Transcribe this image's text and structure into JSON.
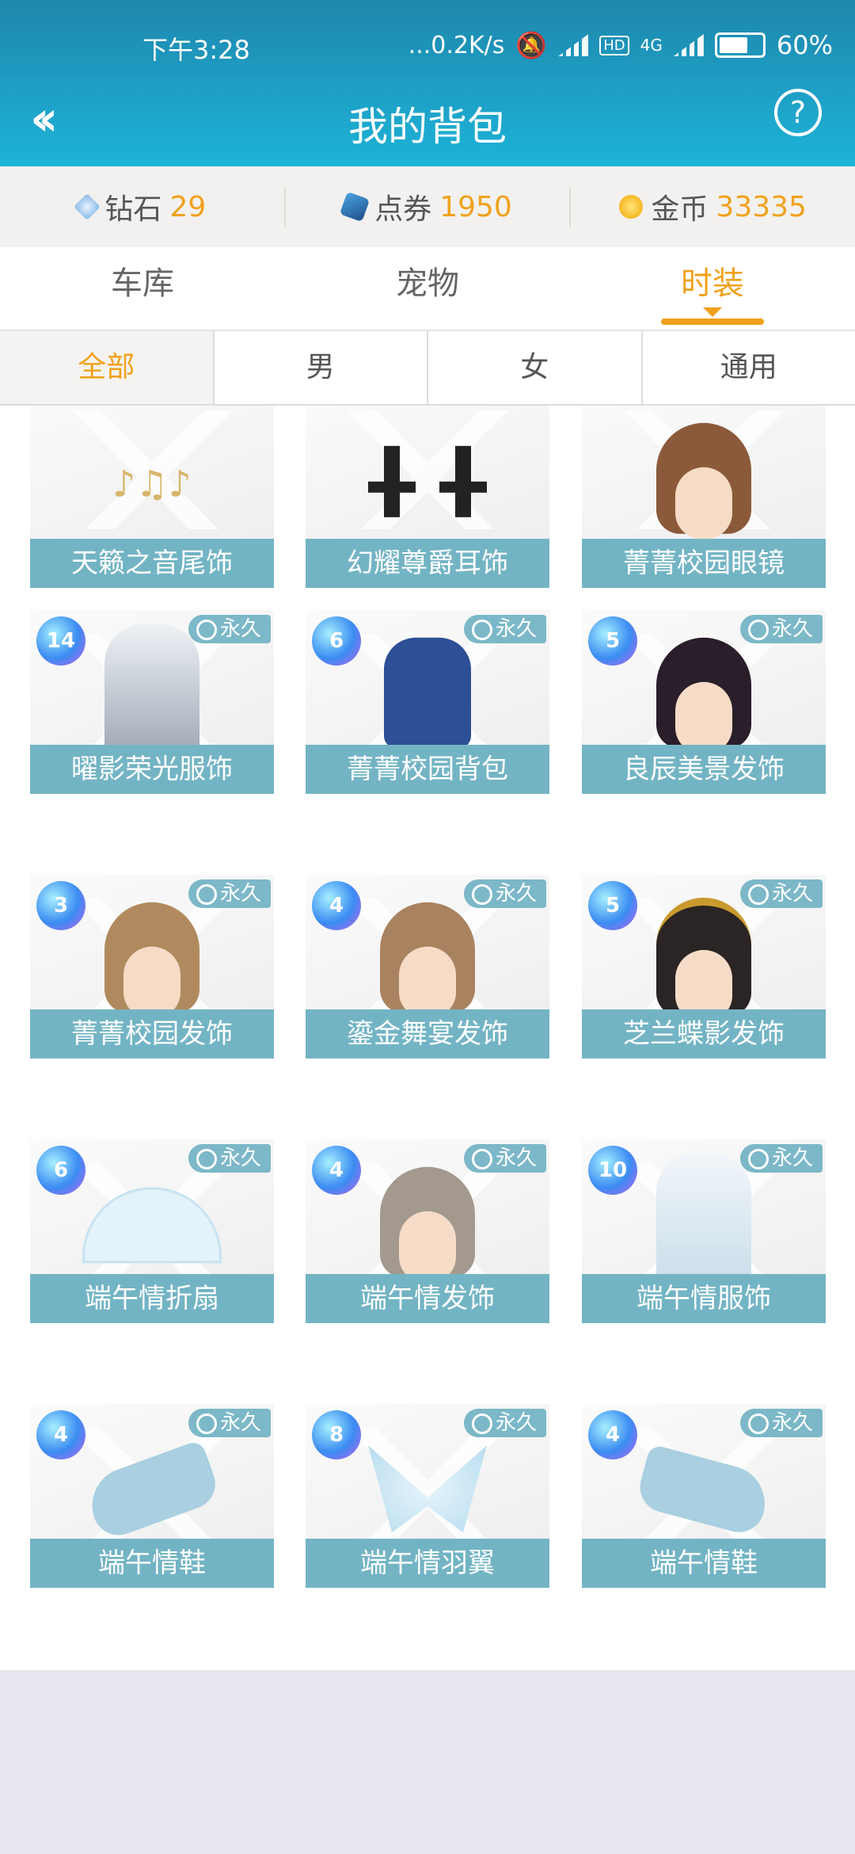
{
  "status_bar": {
    "time": "下午3:28",
    "net_speed": "...0.2K/s",
    "hd": "HD",
    "network": "4G",
    "battery": "60%"
  },
  "header": {
    "title": "我的背包",
    "back_icon": "double-chevron-left-icon",
    "help_icon": "question-circle-icon"
  },
  "currency": {
    "diamond": {
      "label": "钻石",
      "value": "29"
    },
    "ticket": {
      "label": "点券",
      "value": "1950"
    },
    "coin": {
      "label": "金币",
      "value": "33335"
    }
  },
  "tabs": [
    "车库",
    "宠物",
    "时装"
  ],
  "active_tab": "时装",
  "subtabs": [
    "全部",
    "男",
    "女",
    "通用"
  ],
  "active_subtab": "全部",
  "permanent_label": "永久",
  "items": [
    {
      "name": "天籁之音尾饰"
    },
    {
      "name": "幻耀尊爵耳饰"
    },
    {
      "name": "菁菁校园眼镜"
    },
    {
      "name": "曜影荣光服饰",
      "level": "14"
    },
    {
      "name": "菁菁校园背包",
      "level": "6"
    },
    {
      "name": "良辰美景发饰",
      "level": "5"
    },
    {
      "name": "菁菁校园发饰",
      "level": "3"
    },
    {
      "name": "鎏金舞宴发饰",
      "level": "4"
    },
    {
      "name": "芝兰蝶影发饰",
      "level": "5"
    },
    {
      "name": "端午情折扇",
      "level": "6"
    },
    {
      "name": "端午情发饰",
      "level": "4"
    },
    {
      "name": "端午情服饰",
      "level": "10"
    },
    {
      "name": "端午情鞋",
      "level": "4"
    },
    {
      "name": "端午情羽翼",
      "level": "8"
    },
    {
      "name": "端午情鞋",
      "level": "4"
    }
  ],
  "colors": {
    "header": "#1da6cf",
    "accent": "#f0a11b",
    "item_label": "#73b4c4"
  }
}
